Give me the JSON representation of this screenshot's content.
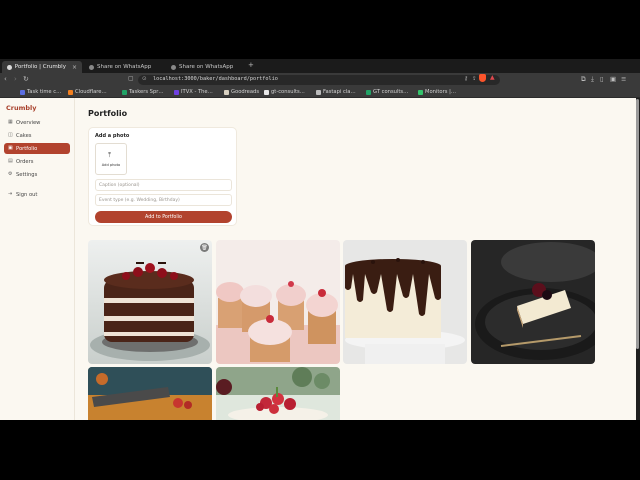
{
  "browser": {
    "tabs": [
      {
        "label": "Portfolio | Crumbly",
        "close": "×",
        "active": true
      },
      {
        "label": "Share on WhatsApp",
        "active": false
      },
      {
        "label": "Share on WhatsApp",
        "active": false
      }
    ],
    "new_tab": "+",
    "url": "localhost:3000/baker/dashboard/portfolio",
    "bookmarks": [
      {
        "label": "Task time c…",
        "color": "#5b6ee1"
      },
      {
        "label": "Cloudflare…",
        "color": "#f38020"
      },
      {
        "label": "Taskers Spr…",
        "color": "#21a366"
      },
      {
        "label": "ITVX - The…",
        "color": "#6e3fe0"
      },
      {
        "label": "Goodreads",
        "color": "#d8d0c0"
      },
      {
        "label": "gt-consults…",
        "color": "#e8e8e8"
      },
      {
        "label": "Fastapi cla…",
        "color": "#bbbbbb"
      },
      {
        "label": "GT consults…",
        "color": "#21a366"
      },
      {
        "label": "Monitors |…",
        "color": "#34c36c"
      }
    ]
  },
  "sidebar": {
    "brand": "Crumbly",
    "items": [
      {
        "label": "Overview",
        "icon": "grid-icon",
        "active": false
      },
      {
        "label": "Cakes",
        "icon": "cake-icon",
        "active": false
      },
      {
        "label": "Portfolio",
        "icon": "image-icon",
        "active": true
      },
      {
        "label": "Orders",
        "icon": "orders-icon",
        "active": false
      },
      {
        "label": "Settings",
        "icon": "gear-icon",
        "active": false
      }
    ],
    "signout": "Sign out"
  },
  "main": {
    "title": "Portfolio",
    "form": {
      "title": "Add a photo",
      "upload_label": "Add photo",
      "caption_placeholder": "Caption (optional)",
      "event_placeholder": "Event type (e.g. Wedding, Birthday)",
      "submit": "Add to Portfolio"
    },
    "gallery": [
      {
        "subject": "black forest cake"
      },
      {
        "subject": "strawberry cupcakes"
      },
      {
        "subject": "chocolate drip cake"
      },
      {
        "subject": "cheesecake slice"
      },
      {
        "subject": "tart with strawberries"
      },
      {
        "subject": "strawberry cake"
      }
    ]
  },
  "colors": {
    "accent": "#b2432e",
    "page_bg": "#fbf8f1"
  }
}
